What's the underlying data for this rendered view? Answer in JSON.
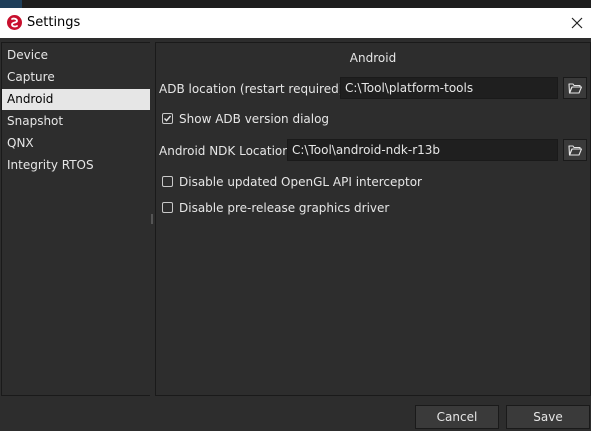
{
  "window": {
    "title": "Settings",
    "app_icon": "qualcomm-snapdragon-logo",
    "close_icon": "close-icon"
  },
  "sidebar": {
    "items": [
      {
        "label": "Device",
        "selected": false
      },
      {
        "label": "Capture",
        "selected": false
      },
      {
        "label": "Android",
        "selected": true
      },
      {
        "label": "Snapshot",
        "selected": false
      },
      {
        "label": "QNX",
        "selected": false
      },
      {
        "label": "Integrity RTOS",
        "selected": false
      }
    ]
  },
  "android": {
    "section_title": "Android",
    "adb_location": {
      "label": "ADB location (restart required)",
      "value": "C:\\Tool\\platform-tools",
      "browse_icon": "folder-icon"
    },
    "show_adb_version_dialog": {
      "label": "Show ADB version dialog",
      "checked": true
    },
    "ndk_location": {
      "label": "Android NDK Location",
      "value": "C:\\Tool\\android-ndk-r13b",
      "browse_icon": "folder-icon"
    },
    "disable_opengl_interceptor": {
      "label": "Disable updated OpenGL API interceptor",
      "checked": false
    },
    "disable_prerelease_driver": {
      "label": "Disable pre-release graphics driver",
      "checked": false
    }
  },
  "buttons": {
    "cancel": "Cancel",
    "save": "Save"
  },
  "colors": {
    "background": "#2d2d2d",
    "selected_item": "#e6e6e6",
    "input_background": "#1f1f1f",
    "brand_red": "#c8102e"
  }
}
